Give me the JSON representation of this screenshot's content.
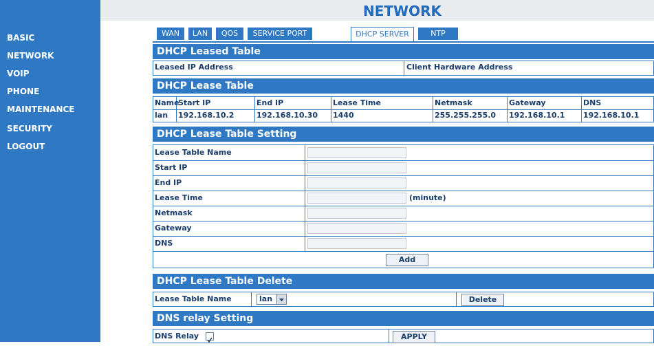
{
  "nav": {
    "items": [
      "BASIC",
      "NETWORK",
      "VOIP",
      "PHONE",
      "MAINTENANCE",
      "SECURITY",
      "LOGOUT"
    ]
  },
  "page_title": "NETWORK",
  "tabs": [
    "WAN",
    "LAN",
    "QOS",
    "SERVICE PORT",
    "DHCP SERVER",
    "NTP"
  ],
  "active_tab": "DHCP SERVER",
  "leased_table": {
    "title": "DHCP Leased Table",
    "columns": [
      "Leased IP Address",
      "Client Hardware Address"
    ]
  },
  "lease_table": {
    "title": "DHCP Lease Table",
    "columns": [
      "Name",
      "Start IP",
      "End IP",
      "Lease Time",
      "Netmask",
      "Gateway",
      "DNS"
    ],
    "rows": [
      [
        "lan",
        "192.168.10.2",
        "192.168.10.30",
        "1440",
        "255.255.255.0",
        "192.168.10.1",
        "192.168.10.1"
      ]
    ]
  },
  "lease_setting": {
    "title": "DHCP Lease Table Setting",
    "fields": [
      "Lease Table Name",
      "Start IP",
      "End IP",
      "Lease Time",
      "Netmask",
      "Gateway",
      "DNS"
    ],
    "lease_time_unit": "(minute)",
    "add_label": "Add"
  },
  "lease_delete": {
    "title": "DHCP Lease Table Delete",
    "label": "Lease Table Name",
    "selected": "lan",
    "delete_label": "Delete"
  },
  "dns_relay": {
    "title": "DNS relay Setting",
    "label": "DNS Relay",
    "checked": true,
    "apply_label": "APPLY"
  },
  "colors": {
    "accent": "#2e78c4",
    "title_text": "#1f6cbf",
    "label_text": "#1a3d6b"
  }
}
